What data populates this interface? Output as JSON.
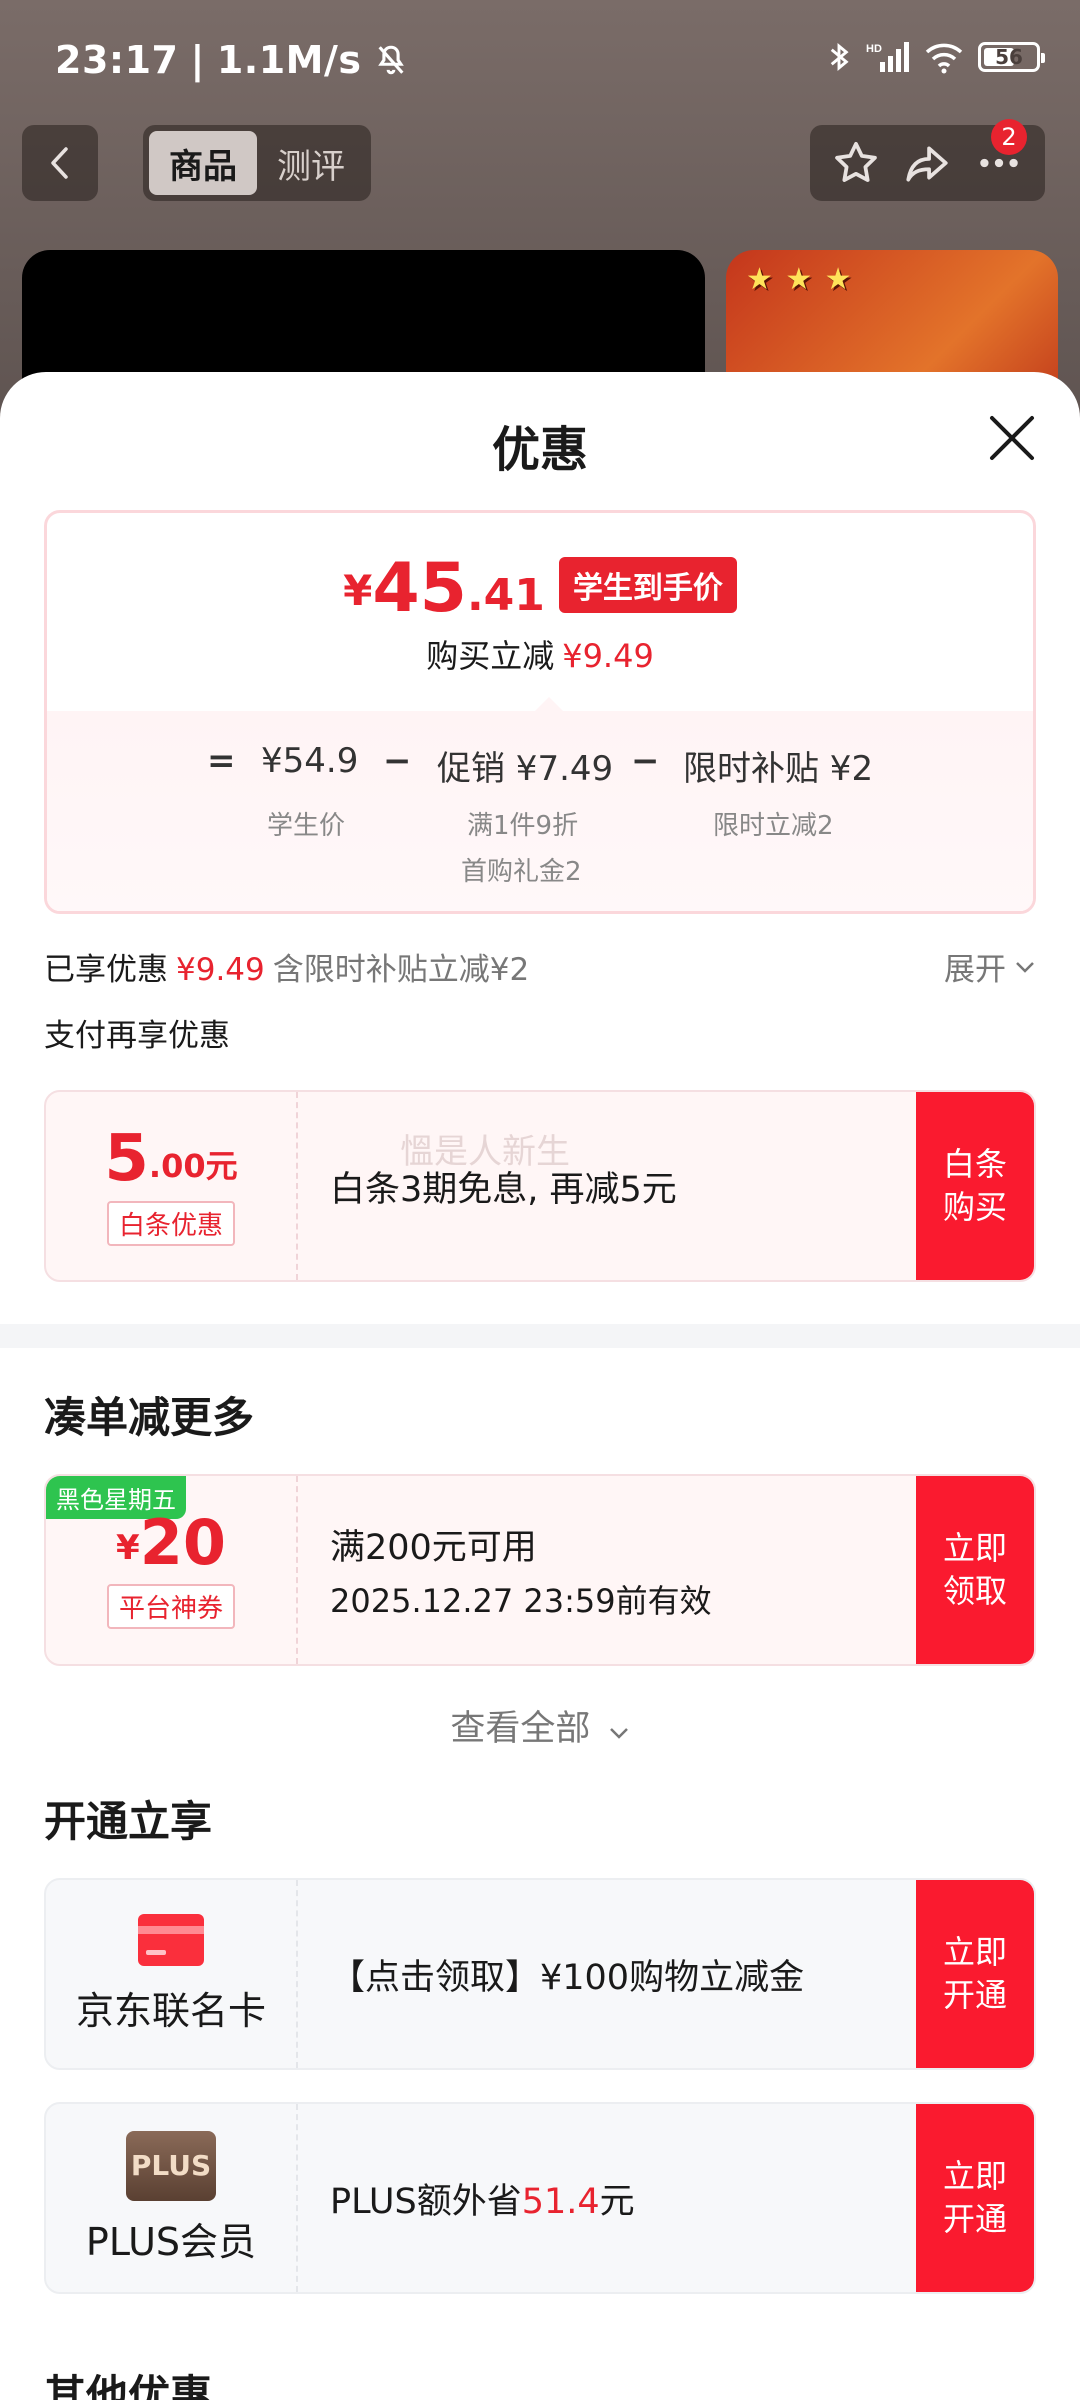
{
  "status_bar": {
    "time": "23:17",
    "speed": "1.1M/s",
    "battery": "56"
  },
  "nav": {
    "tabs": [
      {
        "label": "商品",
        "active": true
      },
      {
        "label": "测评",
        "active": false
      }
    ],
    "badge_count": "2"
  },
  "sheet": {
    "title": "优惠",
    "price_card": {
      "currency": "¥",
      "price_int": "45",
      "price_dec": ".41",
      "tag": "学生到手价",
      "buy_reduce_label": "购买立减",
      "buy_reduce_value": "¥9.49",
      "formula": {
        "equals": "=",
        "student_price": "¥54.9",
        "student_price_label": "学生价",
        "minus1": "−",
        "promo": "促销 ¥7.49",
        "promo_sub1": "满1件9折",
        "promo_sub2": "首购礼金2",
        "minus2": "−",
        "subsidy": "限时补贴 ¥2",
        "subsidy_sub": "限时立减2"
      }
    },
    "enjoyed": {
      "label": "已享优惠",
      "value": "¥9.49",
      "note": "含限时补贴立减¥2",
      "expand": "展开"
    },
    "pay_more": "支付再享优惠",
    "baitiao_coupon": {
      "amount_int": "5",
      "amount_dec": ".00元",
      "tag": "白条优惠",
      "desc": "白条3期免息, 再减5元",
      "button": "白条购买",
      "watermark": "慍是人新生"
    },
    "section_more": "凑单减更多",
    "platform_coupon": {
      "promo_label": "黑色星期五",
      "currency": "¥",
      "amount": "20",
      "tag": "平台神券",
      "condition": "满200元可用",
      "validity": "2025.12.27 23:59前有效",
      "button": "立即领取"
    },
    "see_all": "查看全部",
    "section_open": "开通立享",
    "jd_card": {
      "name": "京东联名卡",
      "desc": "【点击领取】¥100购物立减金",
      "button": "立即开通"
    },
    "plus": {
      "logo": "PLUS",
      "name": "PLUS会员",
      "desc_prefix": "PLUS额外省",
      "desc_value": "51.4",
      "desc_suffix": "元",
      "button": "立即开通"
    },
    "section_other": "其他优惠"
  },
  "colors": {
    "accent_red": "#e8232f",
    "button_red": "#fa1a2f",
    "promo_green": "#2ec44f"
  },
  "icons": [
    "back-icon",
    "star-icon",
    "share-icon",
    "more-icon",
    "close-icon",
    "chevron-down-icon",
    "card-icon",
    "bell-off-icon",
    "bluetooth-icon",
    "signal-icon",
    "wifi-icon"
  ]
}
